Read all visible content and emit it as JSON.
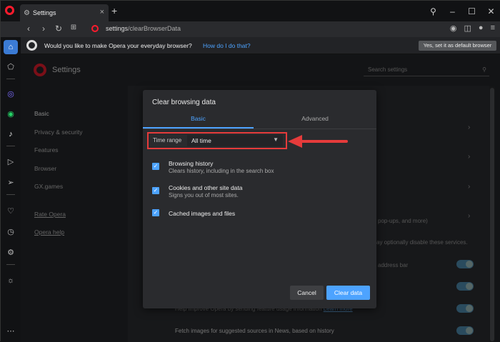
{
  "browser": {
    "tab_title": "Settings",
    "url_host": "settings",
    "url_path": "/clearBrowserData"
  },
  "infobar": {
    "question": "Would you like to make Opera your everyday browser?",
    "link": "How do I do that?",
    "default_button": "Yes, set it as default browser"
  },
  "settings": {
    "title": "Settings",
    "search_placeholder": "Search settings",
    "nav": [
      "Basic",
      "Privacy & security",
      "Features",
      "Browser",
      "GX.games"
    ],
    "links": [
      "Rate Opera",
      "Opera help"
    ],
    "bg_text_1": "pop-ups, and more)",
    "bg_text_2": "ay optionally disable these services.",
    "bg_text_3": "address bar",
    "bg_text_4": "Help improve Opera by sending feature usage information",
    "bg_text_4_link": "Learn more",
    "bg_text_5": "Fetch images for suggested sources in News, based on history"
  },
  "dialog": {
    "title": "Clear browsing data",
    "tab_basic": "Basic",
    "tab_advanced": "Advanced",
    "time_range_label": "Time range",
    "time_range_value": "All time",
    "options": [
      {
        "title": "Browsing history",
        "subtitle": "Clears history, including in the search box",
        "checked": true
      },
      {
        "title": "Cookies and other site data",
        "subtitle": "Signs you out of most sites.",
        "checked": true
      },
      {
        "title": "Cached images and files",
        "subtitle": "",
        "checked": true
      }
    ],
    "cancel": "Cancel",
    "clear": "Clear data"
  },
  "colors": {
    "accent": "#4da3ff",
    "opera_red": "#ff1b2d",
    "annotation_red": "#e53b3b"
  }
}
